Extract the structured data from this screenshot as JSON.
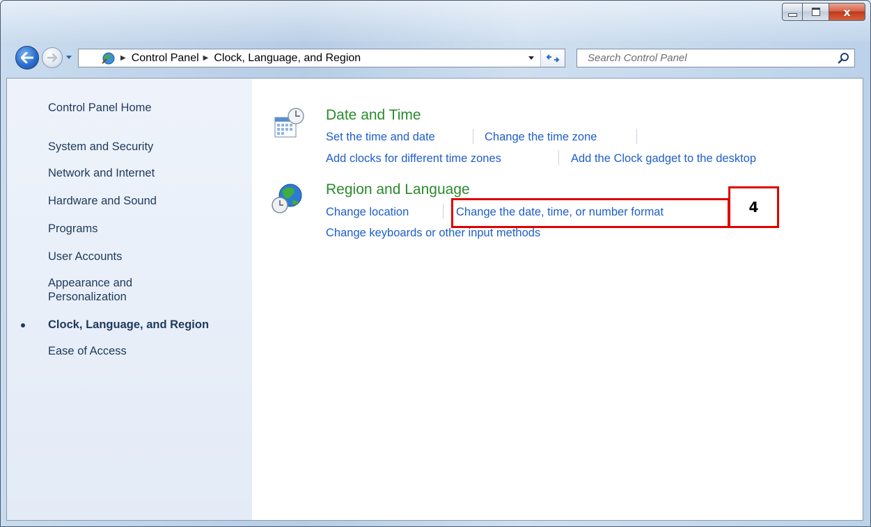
{
  "window": {
    "caption_close_glyph": "x"
  },
  "nav": {
    "breadcrumbs": [
      "Control Panel",
      "Clock, Language, and Region"
    ],
    "search_placeholder": "Search Control Panel"
  },
  "sidebar": {
    "items": [
      {
        "label": "Control Panel Home"
      },
      {
        "label": "System and Security"
      },
      {
        "label": "Network and Internet"
      },
      {
        "label": "Hardware and Sound"
      },
      {
        "label": "Programs"
      },
      {
        "label": "User Accounts"
      },
      {
        "label": "Appearance and Personalization"
      },
      {
        "label": "Clock, Language, and Region",
        "active": true
      },
      {
        "label": "Ease of Access"
      }
    ]
  },
  "categories": [
    {
      "title": "Date and Time",
      "icon": "clock-calendar-icon",
      "tasks": [
        "Set the time and date",
        "Change the time zone",
        "Add clocks for different time zones",
        "Add the Clock gadget to the desktop"
      ]
    },
    {
      "title": "Region and Language",
      "icon": "globe-clock-icon",
      "tasks": [
        "Change location",
        "Change the date, time, or number format",
        "Change keyboards or other input methods"
      ]
    }
  ],
  "annotation": {
    "label": "4",
    "color": "#e00000"
  },
  "colors": {
    "category_title": "#2a8a2c",
    "task_link": "#1e5ec8",
    "sidebar_text": "#1e395b"
  }
}
